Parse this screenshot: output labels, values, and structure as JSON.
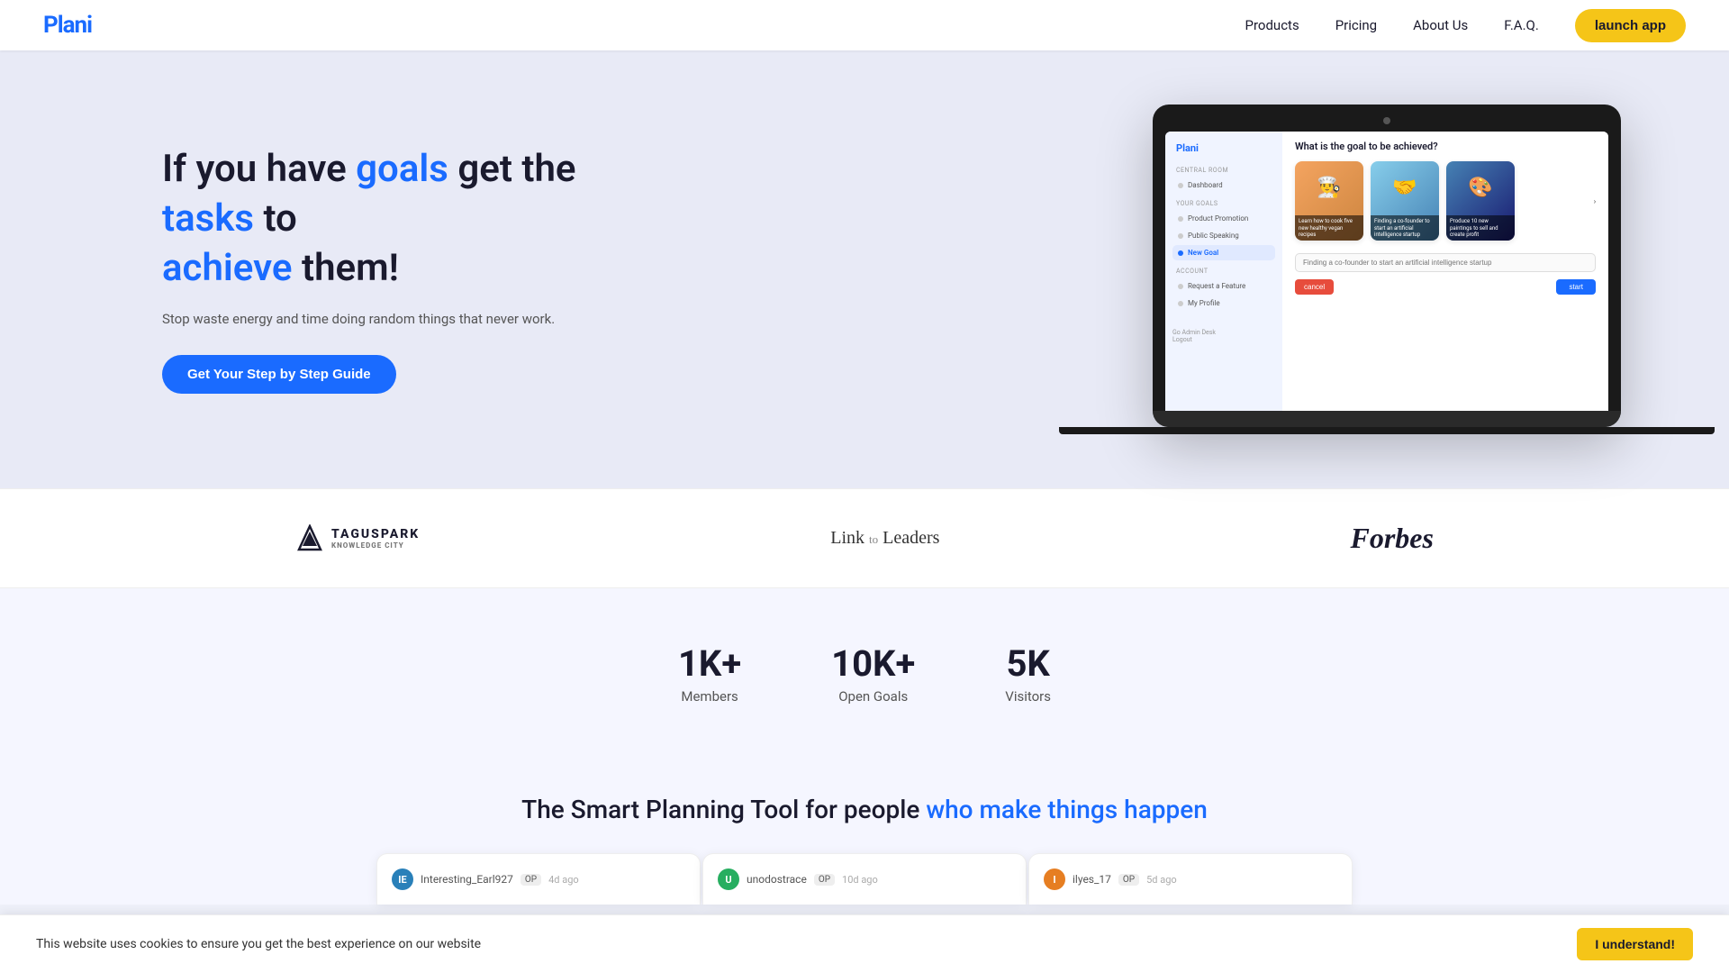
{
  "nav": {
    "logo": "Plani",
    "links": [
      {
        "label": "Products",
        "id": "products"
      },
      {
        "label": "Pricing",
        "id": "pricing"
      },
      {
        "label": "About Us",
        "id": "about"
      },
      {
        "label": "F.A.Q.",
        "id": "faq"
      }
    ],
    "launch_btn": "launch app"
  },
  "hero": {
    "headline_pre": "If you have ",
    "headline_goals": "goals",
    "headline_mid": " get the ",
    "headline_tasks": "tasks",
    "headline_post": " to",
    "headline_achieve": "achieve",
    "headline_end": " them!",
    "subtext": "Stop waste energy and time doing random things that never work.",
    "cta_label": "Get Your Step by Step Guide"
  },
  "app_mockup": {
    "logo": "Plani",
    "sidebar_sections": [
      {
        "title": "CENTRAL ROOM",
        "items": [
          {
            "label": "Dashboard",
            "active": false
          }
        ]
      },
      {
        "title": "YOUR GOALS",
        "items": [
          {
            "label": "Product Promotion",
            "active": false
          },
          {
            "label": "Public Speaking",
            "active": false
          },
          {
            "label": "New Goal",
            "active": true
          }
        ]
      },
      {
        "title": "ACCOUNT",
        "items": [
          {
            "label": "Request a Feature",
            "active": false
          },
          {
            "label": "My Profile",
            "active": false
          }
        ]
      }
    ],
    "footer_items": [
      {
        "label": "Go Admin Desk"
      },
      {
        "label": "Logout"
      }
    ],
    "main_question": "What is the goal to be achieved?",
    "cards": [
      {
        "label": "Learn how to cook five new healthy vegan recipes",
        "emoji": "👨‍🍳"
      },
      {
        "label": "Finding a co-founder to start an artificial intelligence startup",
        "emoji": "🤝"
      },
      {
        "label": "Produce 10 new paintings to sell and create profit",
        "emoji": "🎨"
      }
    ],
    "input_placeholder": "Finding a co-founder to start an artificial intelligence startup",
    "cancel_label": "cancel",
    "start_label": "start"
  },
  "press": {
    "logos": [
      {
        "name": "TAGUSPARK",
        "type": "taguspark",
        "subtitle": "KNOWLEDGE CITY"
      },
      {
        "name": "Link to Leaders",
        "type": "link-leaders"
      },
      {
        "name": "Forbes",
        "type": "forbes"
      }
    ]
  },
  "stats": [
    {
      "number": "1K+",
      "label": "Members"
    },
    {
      "number": "10K+",
      "label": "Open Goals"
    },
    {
      "number": "5K",
      "label": "Visitors"
    }
  ],
  "smart_section": {
    "title_pre": "The Smart Planning Tool for people ",
    "title_highlight": "who make things happen"
  },
  "preview_cards": [
    {
      "user": "Interesting_Earl927",
      "badge": "OP",
      "time": "4d ago",
      "av": "IE",
      "av_class": "av1"
    },
    {
      "user": "unodostrace",
      "badge": "OP",
      "time": "10d ago",
      "av": "U",
      "av_class": "av2"
    },
    {
      "user": "ilyes_17",
      "badge": "OP",
      "time": "5d ago",
      "av": "I",
      "av_class": "av3"
    }
  ],
  "cookie": {
    "text": "This website uses cookies to ensure you get the best experience on our website",
    "btn_label": "I understand!"
  }
}
